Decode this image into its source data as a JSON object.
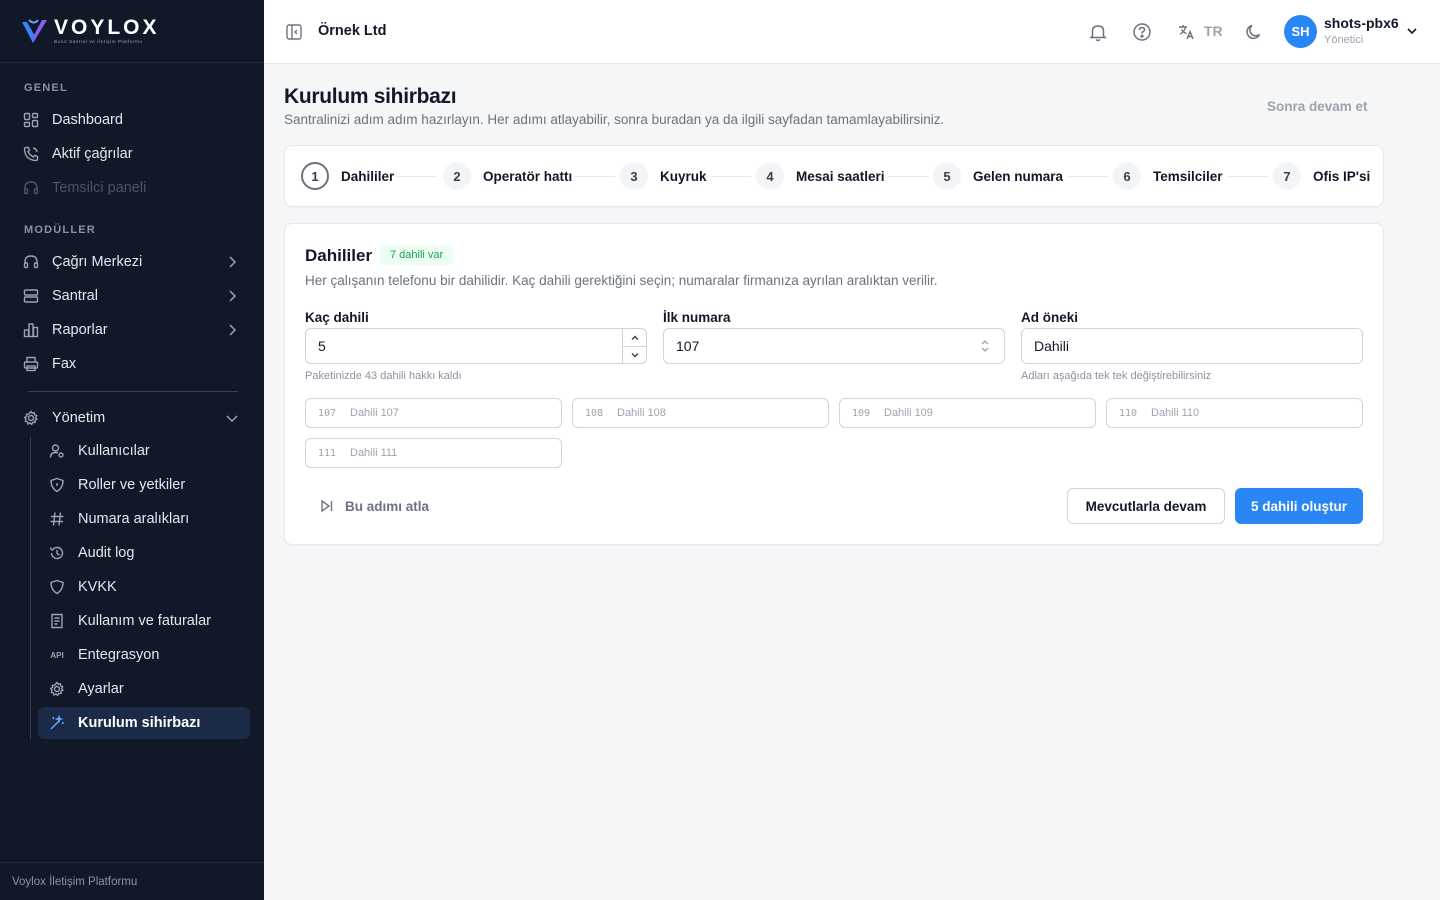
{
  "brand": {
    "name": "VOYLOX",
    "tagline": "Bulut Santral ve İletişim Platformu",
    "footer": "Voylox İletişim Platformu"
  },
  "sidebar": {
    "section_general": "GENEL",
    "general_items": [
      {
        "label": "Dashboard",
        "icon": "grid-icon"
      },
      {
        "label": "Aktif çağrılar",
        "icon": "phone-icon"
      },
      {
        "label": "Temsilci paneli",
        "icon": "headset-icon",
        "disabled": true
      }
    ],
    "section_modules": "MODÜLLER",
    "module_items": [
      {
        "label": "Çağrı Merkezi",
        "icon": "headset-icon"
      },
      {
        "label": "Santral",
        "icon": "server-icon"
      },
      {
        "label": "Raporlar",
        "icon": "chart-icon"
      },
      {
        "label": "Fax",
        "icon": "printer-icon"
      }
    ],
    "admin": {
      "label": "Yönetim",
      "icon": "gear-icon"
    },
    "admin_items": [
      {
        "label": "Kullanıcılar",
        "icon": "user-gear-icon"
      },
      {
        "label": "Roller ve yetkiler",
        "icon": "shield-icon"
      },
      {
        "label": "Numara aralıkları",
        "icon": "hash-icon"
      },
      {
        "label": "Audit log",
        "icon": "history-icon"
      },
      {
        "label": "KVKK",
        "icon": "shield-outline-icon"
      },
      {
        "label": "Kullanım ve faturalar",
        "icon": "receipt-icon"
      },
      {
        "label": "Entegrasyon",
        "icon": "api-icon",
        "glyph": "API"
      },
      {
        "label": "Ayarlar",
        "icon": "gear-icon"
      },
      {
        "label": "Kurulum sihirbazı",
        "icon": "wand-icon",
        "active": true
      }
    ]
  },
  "header": {
    "company": "Örnek Ltd",
    "language": "TR",
    "user": {
      "initials": "SH",
      "name": "shots-pbx6",
      "role": "Yönetici"
    }
  },
  "page": {
    "title": "Kurulum sihirbazı",
    "subtitle": "Santralinizi adım adım hazırlayın. Her adımı atlayabilir, sonra buradan ya da ilgili sayfadan tamamlayabilirsiniz.",
    "later": "Sonra devam et"
  },
  "steps": [
    {
      "num": "1",
      "label": "Dahililer",
      "active": true
    },
    {
      "num": "2",
      "label": "Operatör hattı"
    },
    {
      "num": "3",
      "label": "Kuyruk"
    },
    {
      "num": "4",
      "label": "Mesai saatleri"
    },
    {
      "num": "5",
      "label": "Gelen numara"
    },
    {
      "num": "6",
      "label": "Temsilciler"
    },
    {
      "num": "7",
      "label": "Ofis IP'si"
    }
  ],
  "card": {
    "title": "Dahililer",
    "badge": "7 dahili var",
    "description": "Her çalışanın telefonu bir dahilidir. Kaç dahili gerektiğini seçin; numaralar firmanıza ayrılan aralıktan verilir.",
    "count": {
      "label": "Kaç dahili",
      "value": "5",
      "hint": "Paketinizde 43 dahili hakkı kaldı"
    },
    "first": {
      "label": "İlk numara",
      "value": "107"
    },
    "prefix": {
      "label": "Ad öneki",
      "value": "Dahili",
      "hint": "Adları aşağıda tek tek değiştirebilirsiniz"
    },
    "extensions": [
      {
        "num": "107",
        "name": "Dahili 107"
      },
      {
        "num": "108",
        "name": "Dahili 108"
      },
      {
        "num": "109",
        "name": "Dahili 109"
      },
      {
        "num": "110",
        "name": "Dahili 110"
      },
      {
        "num": "111",
        "name": "Dahili 111"
      }
    ],
    "skip": "Bu adımı atla",
    "continue": "Mevcutlarla devam",
    "create": "5 dahili oluştur"
  },
  "colors": {
    "sidebar_bg": "#111827",
    "accent": "#2b86f5",
    "badge_green": "#16a34a",
    "active_item_bg": "#1b2a46"
  }
}
